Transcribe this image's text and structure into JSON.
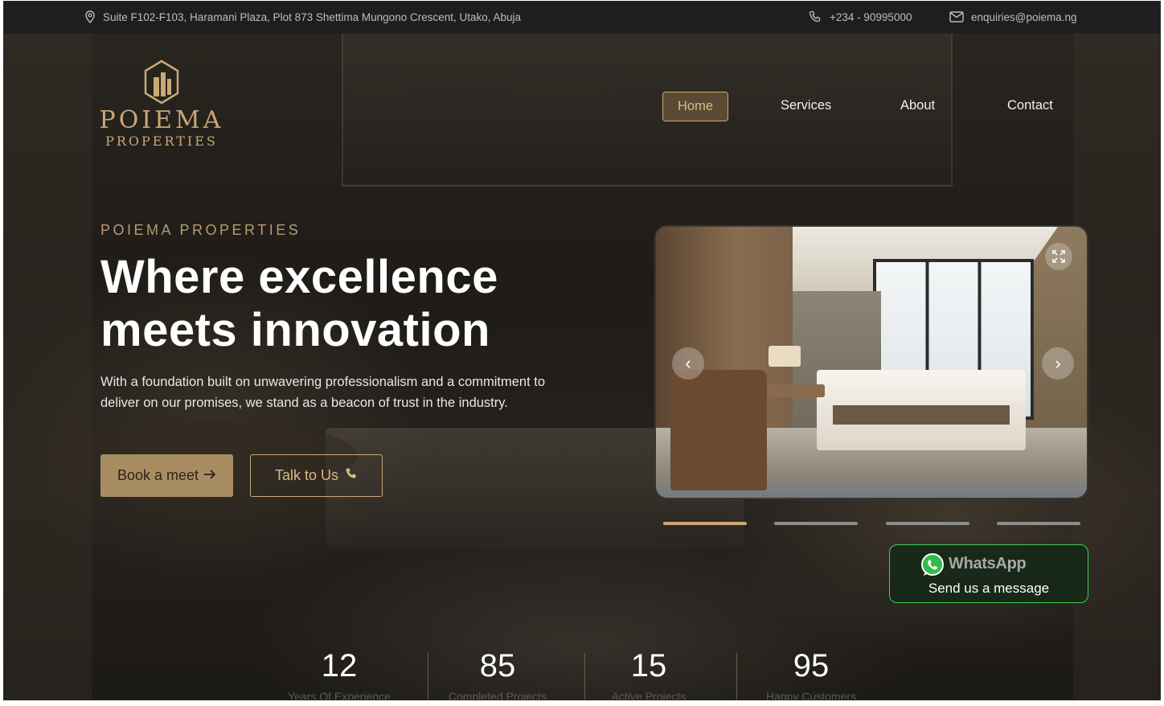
{
  "topbar": {
    "address": "Suite F102-F103, Haramani Plaza, Plot 873 Shettima Mungono Crescent, Utako, Abuja",
    "phone": "+234 - 90995000",
    "email": "enquiries@poiema.ng"
  },
  "logo": {
    "line1": "POIEMA",
    "line2": "PROPERTIES"
  },
  "nav": {
    "items": [
      "Home",
      "Services",
      "About",
      "Contact"
    ],
    "active": "Home"
  },
  "hero": {
    "eyebrow": "POIEMA PROPERTIES",
    "headline_line1": "Where excellence",
    "headline_line2": "meets innovation",
    "description": "With a foundation built on unwavering professionalism and a commitment to deliver on our promises, we stand as a beacon of trust in the industry.",
    "primary_button": "Book a meet",
    "secondary_button": "Talk to Us"
  },
  "carousel": {
    "slide_count": 4,
    "active_index": 0
  },
  "whatsapp": {
    "title": "WhatsApp",
    "subtitle": "Send us a message"
  },
  "stats": [
    {
      "value": "12",
      "label": "Years Of Experience"
    },
    {
      "value": "85",
      "label": "Completed Projects"
    },
    {
      "value": "15",
      "label": "Active Projects"
    },
    {
      "value": "95",
      "label": "Happy Customers"
    }
  ],
  "colors": {
    "accent": "#c9a876",
    "button_fill": "#a88d63",
    "whatsapp": "#3ccf5a",
    "topbar": "#1e1e1e"
  }
}
